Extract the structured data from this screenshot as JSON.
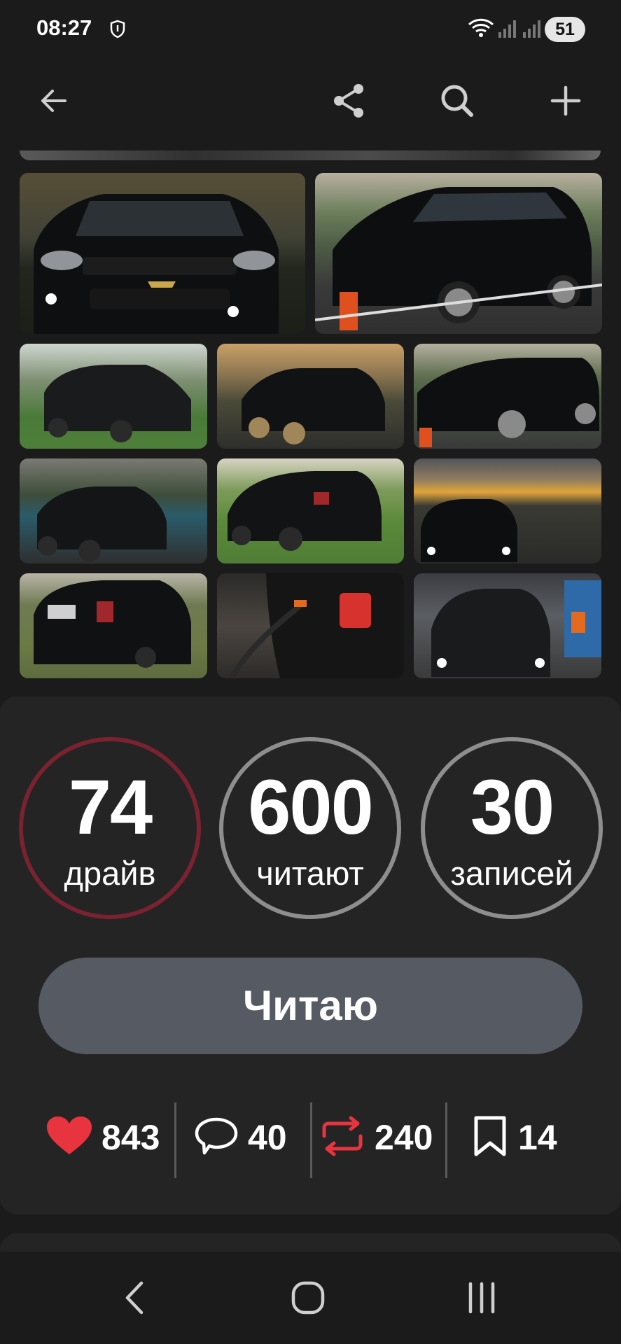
{
  "status_bar": {
    "time": "08:27",
    "battery": "51",
    "icons": [
      "shield-icon",
      "wifi-icon",
      "signal-icon",
      "signal-icon"
    ]
  },
  "toolbar": {
    "icons": [
      "back-arrow-icon",
      "share-icon",
      "search-icon",
      "plus-icon"
    ]
  },
  "stats": [
    {
      "value": "74",
      "label": "драйв",
      "ring_color": "#7a2230"
    },
    {
      "value": "600",
      "label": "читают",
      "ring_color": "#8e8e8e"
    },
    {
      "value": "30",
      "label": "записей",
      "ring_color": "#8e8e8e"
    }
  ],
  "follow_button": {
    "label": "Читаю"
  },
  "actions": [
    {
      "icon": "heart-icon",
      "count": "843"
    },
    {
      "icon": "comment-icon",
      "count": "40"
    },
    {
      "icon": "repost-icon",
      "count": "240"
    },
    {
      "icon": "bookmark-icon",
      "count": "14"
    }
  ],
  "colors": {
    "background": "#1b1b1c",
    "card": "#242425",
    "button": "#555a63",
    "heart": "#e8343f",
    "repost": "#e8343f"
  },
  "nav_bar": {
    "icons": [
      "back-icon",
      "home-icon",
      "recents-icon"
    ]
  }
}
